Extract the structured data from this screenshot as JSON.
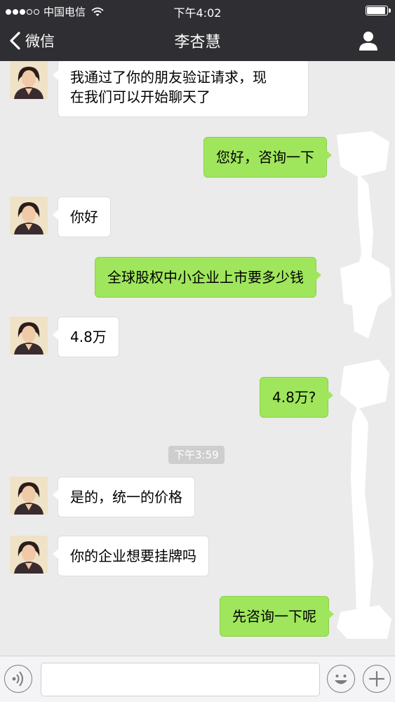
{
  "status_bar": {
    "carrier": "中国电信",
    "time": "下午4:02",
    "signal_dots_filled": 3,
    "signal_dots_total": 5,
    "battery_level": 0.85
  },
  "nav": {
    "back_label": "微信",
    "title": "李杏慧",
    "profile_icon": "person-icon"
  },
  "messages": [
    {
      "side": "in",
      "text_lines": [
        "我通过了你的朋友验证请求，现",
        "在我们可以开始聊天了"
      ]
    },
    {
      "side": "out",
      "text": "您好，咨询一下"
    },
    {
      "side": "in",
      "text": "你好"
    },
    {
      "side": "out",
      "text": "全球股权中小企业上市要多少钱"
    },
    {
      "side": "in",
      "text": "4.8万"
    },
    {
      "side": "out",
      "text": "4.8万?"
    },
    {
      "side": "in",
      "text": "是的，统一的价格"
    },
    {
      "side": "in",
      "text": "你的企业想要挂牌吗"
    },
    {
      "side": "out",
      "text": "先咨询一下呢"
    }
  ],
  "timestamp": "下午3:59",
  "input_bar": {
    "voice_icon": "voice-icon",
    "input_value": "",
    "emoji_icon": "emoji-icon",
    "add_icon": "plus-icon"
  },
  "colors": {
    "bar_bg": "#2f2f33",
    "chat_bg": "#ebebeb",
    "outgoing_bubble": "#9fe65c",
    "incoming_bubble": "#ffffff"
  }
}
